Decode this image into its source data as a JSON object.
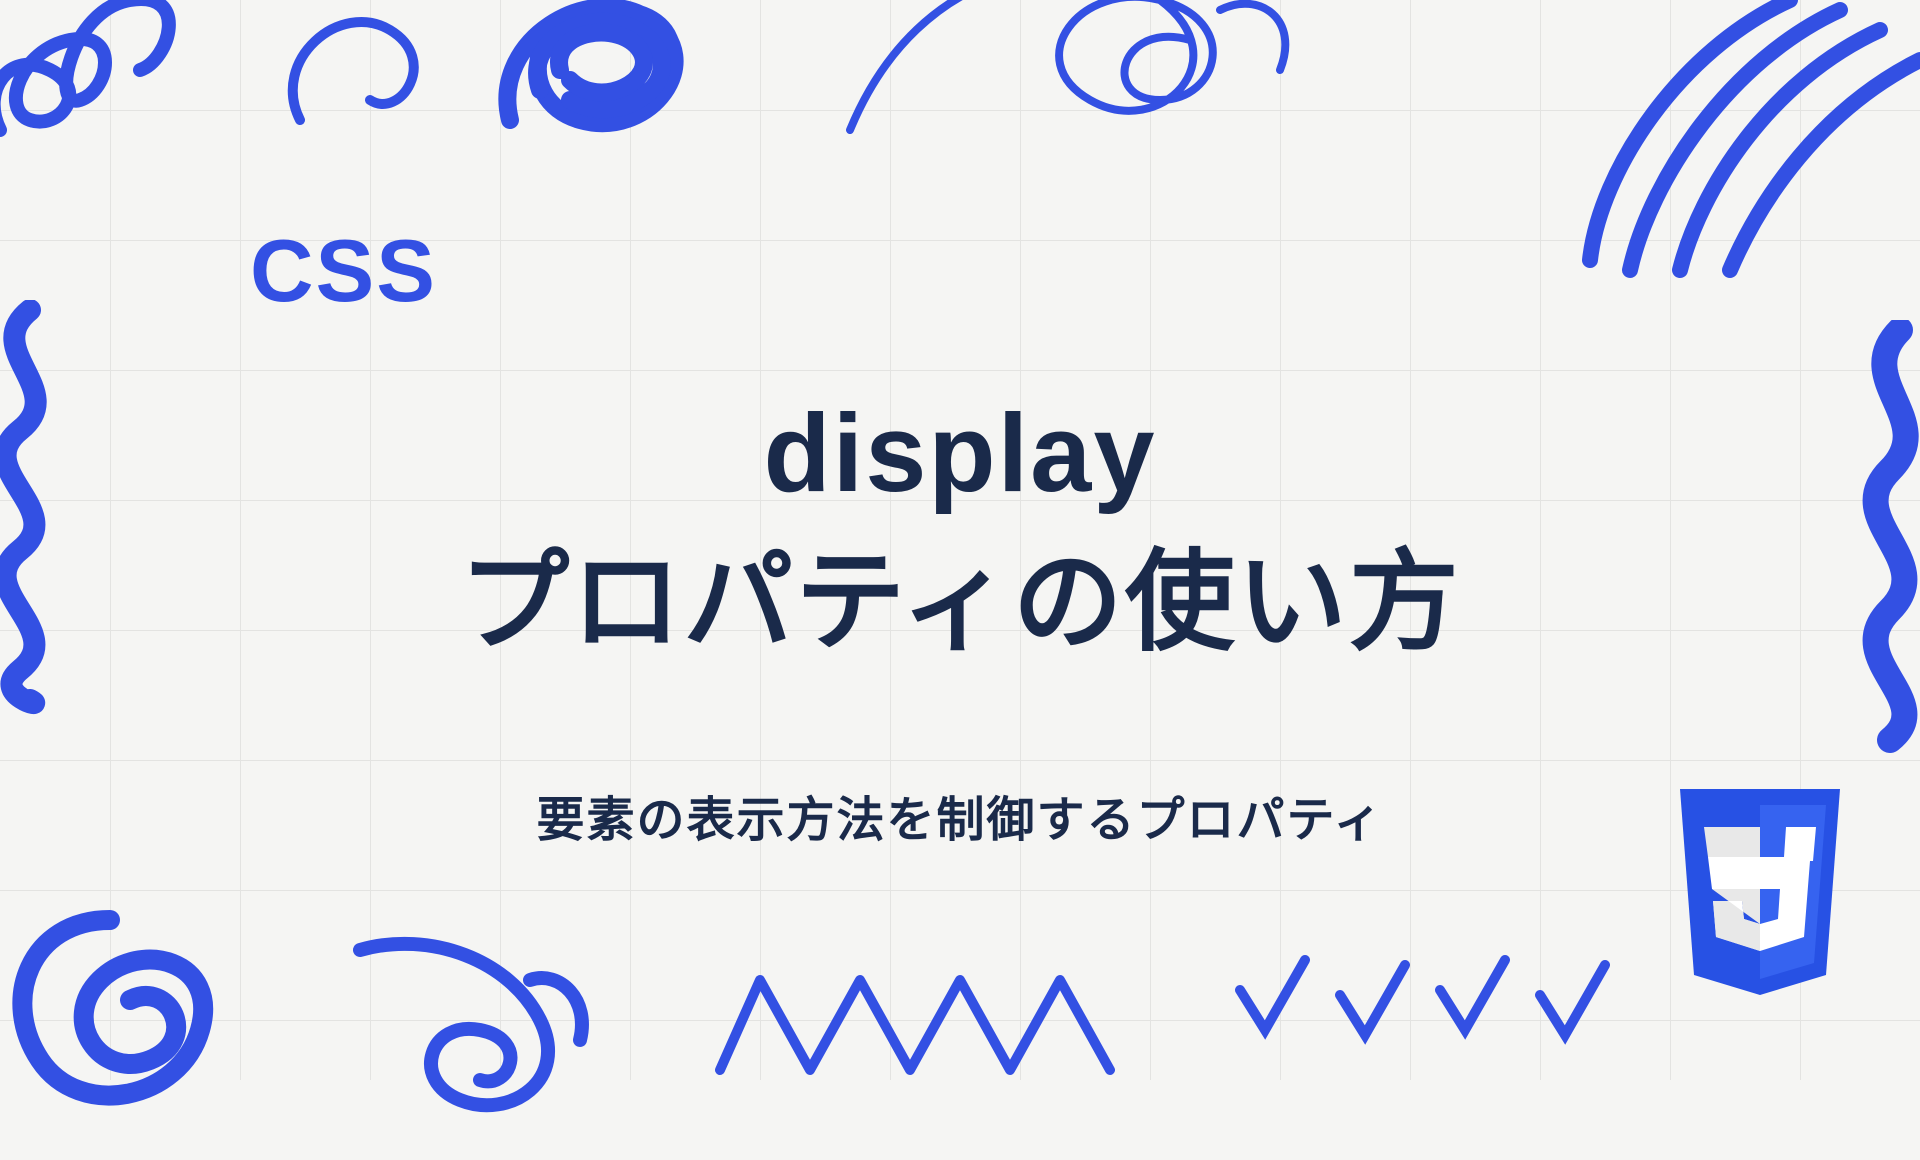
{
  "category": "CSS",
  "title": {
    "line1": "display",
    "line2": "プロパティの使い方"
  },
  "subtitle": "要素の表示方法を制御するプロパティ",
  "badge": {
    "name": "css3-logo",
    "color": "#2751E4"
  },
  "colors": {
    "accent": "#3350e3",
    "heading": "#1a2a4a",
    "background": "#f5f5f3",
    "grid": "#d8d8d6"
  }
}
